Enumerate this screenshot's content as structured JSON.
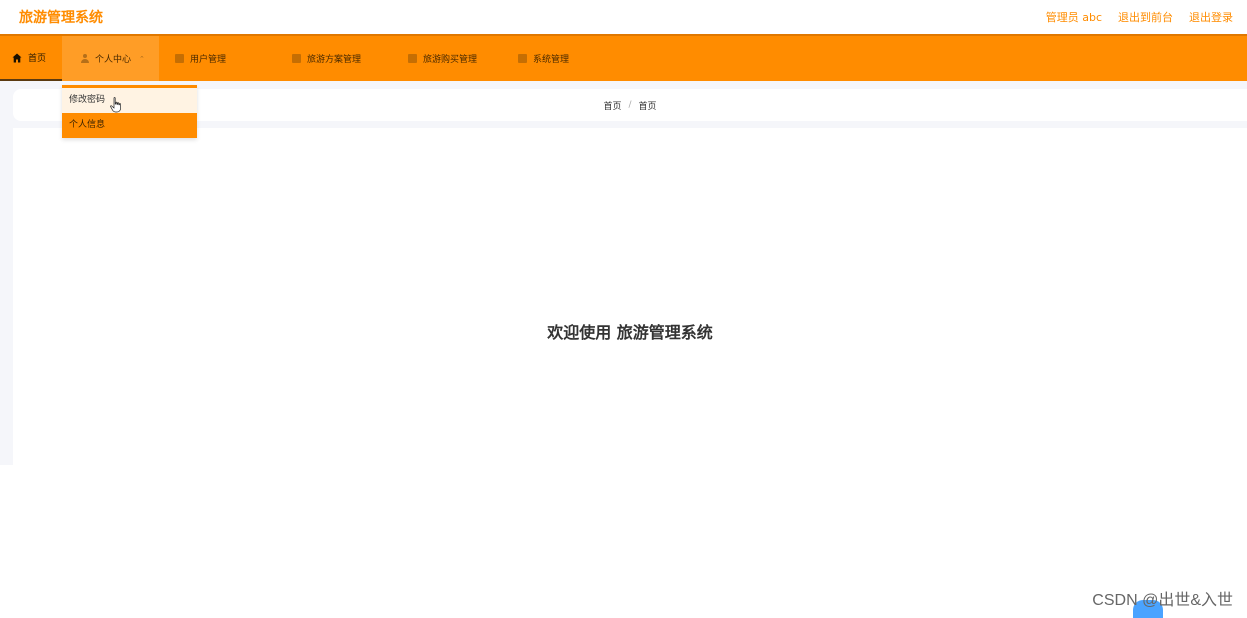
{
  "header": {
    "app_title": "旅游管理系统",
    "admin_label": "管理员 abc",
    "to_frontend": "退出到前台",
    "logout": "退出登录"
  },
  "nav": {
    "items": [
      {
        "label": "首页",
        "icon": "home-icon"
      },
      {
        "label": "个人中心",
        "icon": "user-icon"
      },
      {
        "label": "用户管理",
        "icon": "users-icon"
      },
      {
        "label": "旅游方案管理",
        "icon": "plan-icon"
      },
      {
        "label": "旅游购买管理",
        "icon": "purchase-icon"
      },
      {
        "label": "系统管理",
        "icon": "settings-icon"
      }
    ],
    "active_index": 1
  },
  "dropdown": {
    "items": [
      {
        "label": "修改密码"
      },
      {
        "label": "个人信息"
      }
    ],
    "hover_index": 0
  },
  "breadcrumb": {
    "items": [
      "首页",
      "首页"
    ]
  },
  "main": {
    "welcome": "欢迎使用 旅游管理系统"
  },
  "watermark": {
    "text": "CSDN @出世&入世"
  },
  "colors": {
    "accent": "#ff8c00",
    "background": "#f5f6fa"
  }
}
